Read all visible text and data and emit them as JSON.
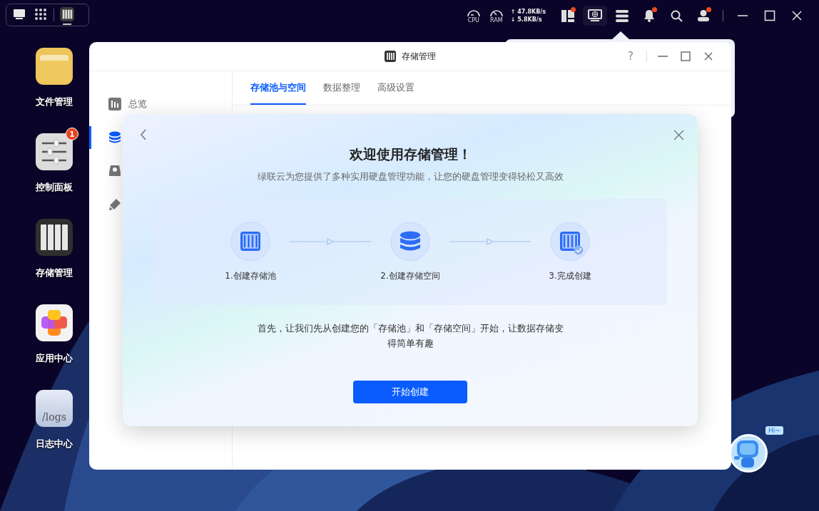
{
  "taskbar": {
    "pinned": [
      {
        "running": false
      },
      {
        "running": false
      },
      {
        "running": true
      }
    ],
    "gauges": [
      {
        "label": "CPU"
      },
      {
        "label": "RAM"
      }
    ],
    "network": {
      "up": "↑ 47.8KB/s",
      "down": "↓ 5.8KB/s"
    },
    "tray": [
      {
        "badge": true,
        "selected": false
      },
      {
        "badge": false,
        "selected": true
      },
      {
        "badge": false,
        "selected": false
      },
      {
        "badge": true,
        "selected": false
      },
      {
        "badge": false,
        "selected": false
      },
      {
        "badge": true,
        "selected": false
      }
    ]
  },
  "desktop_apps": [
    {
      "label": "文件管理"
    },
    {
      "label": "控制面板",
      "badge": "1"
    },
    {
      "label": "存储管理"
    },
    {
      "label": "应用中心"
    },
    {
      "label": "日志中心",
      "icon_text": "/logs"
    }
  ],
  "window": {
    "title": "存储管理",
    "help": "?",
    "sidebar": [
      {
        "label": "总览",
        "selected": false
      },
      {
        "selected": true
      },
      {
        "selected": false
      },
      {
        "selected": false
      }
    ],
    "tabs": [
      {
        "label": "存储池与空间",
        "selected": true
      },
      {
        "label": "数据整理",
        "selected": false
      },
      {
        "label": "高级设置",
        "selected": false
      }
    ]
  },
  "dialog": {
    "title": "欢迎使用存储管理！",
    "subtitle": "绿联云为您提供了多种实用硬盘管理功能，让您的硬盘管理变得轻松又高效",
    "steps": [
      {
        "label": "1.创建存储池"
      },
      {
        "label": "2.创建存储空间"
      },
      {
        "label": "3.完成创建"
      }
    ],
    "message": "首先，让我们先从创建您的「存储池」和「存储空间」开始，让数据存储变得简单有趣",
    "button": "开始创建"
  },
  "assistant": {
    "bubble": "Hi~"
  }
}
